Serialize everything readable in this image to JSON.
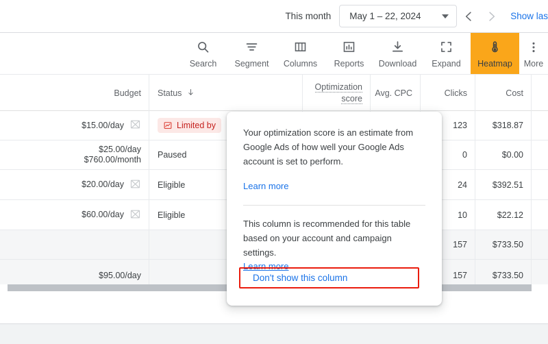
{
  "datebar": {
    "label": "This month",
    "range": "May 1 – 22, 2024",
    "prev_icon": "chevron-left-icon",
    "next_icon": "chevron-right-icon",
    "show_last_link": "Show las"
  },
  "toolbar": {
    "items": [
      {
        "label": "Search",
        "icon": "search-icon",
        "active": false
      },
      {
        "label": "Segment",
        "icon": "segment-icon",
        "active": false
      },
      {
        "label": "Columns",
        "icon": "columns-icon",
        "active": false
      },
      {
        "label": "Reports",
        "icon": "reports-icon",
        "active": false
      },
      {
        "label": "Download",
        "icon": "download-icon",
        "active": false
      },
      {
        "label": "Expand",
        "icon": "expand-icon",
        "active": false
      },
      {
        "label": "Heatmap",
        "icon": "thermometer-icon",
        "active": true
      },
      {
        "label": "More",
        "icon": "more-vertical-icon",
        "active": false
      }
    ],
    "active_color": "#faa61a"
  },
  "table": {
    "headers": {
      "budget": "Budget",
      "status": "Status",
      "status_sort": "descending",
      "optimization_score_line1": "Optimization",
      "optimization_score_line2": "score",
      "avg_cpc": "Avg. CPC",
      "clicks": "Clicks",
      "cost": "Cost"
    },
    "rows": [
      {
        "budget": "$15.00/day",
        "budget_line2": "",
        "has_nochart_icon": true,
        "status": "Limited by",
        "status_is_badge": true,
        "clicks": "123",
        "cost": "$318.87",
        "total": false
      },
      {
        "budget": "$25.00/day",
        "budget_line2": "$760.00/month",
        "has_nochart_icon": false,
        "status": "Paused",
        "status_is_badge": false,
        "clicks": "0",
        "cost": "$0.00",
        "total": false
      },
      {
        "budget": "$20.00/day",
        "budget_line2": "",
        "has_nochart_icon": true,
        "status": "Eligible",
        "status_is_badge": false,
        "clicks": "24",
        "cost": "$392.51",
        "total": false
      },
      {
        "budget": "$60.00/day",
        "budget_line2": "",
        "has_nochart_icon": true,
        "status": "Eligible",
        "status_is_badge": false,
        "clicks": "10",
        "cost": "$22.12",
        "total": false
      },
      {
        "budget": "",
        "budget_line2": "",
        "has_nochart_icon": false,
        "status": "",
        "status_is_badge": false,
        "clicks": "157",
        "cost": "$733.50",
        "total": true
      },
      {
        "budget": "$95.00/day",
        "budget_line2": "",
        "has_nochart_icon": false,
        "status": "",
        "status_is_badge": false,
        "clicks": "157",
        "cost": "$733.50",
        "total": true
      }
    ]
  },
  "tooltip": {
    "paragraph1": "Your optimization score is an estimate from Google Ads of how well your Google Ads account is set to perform.",
    "learn_more_1": "Learn more",
    "paragraph2": "This column is recommended for this table based on your account and campaign settings.",
    "learn_more_2": "Learn more",
    "cta": "Don't show this column",
    "highlight_color": "#ea1c0d"
  }
}
